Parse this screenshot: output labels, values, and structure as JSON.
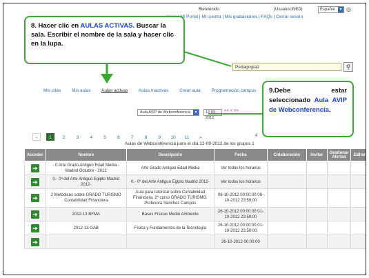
{
  "header": {
    "welcome": "Bienvenido",
    "user": "(UsuarioUNED)",
    "language": "Español",
    "go_label": "",
    "links": "Inicio | Mi Portal | Mi cuenta | Mis grabaciones | FAQs | Cerrar sesión"
  },
  "search": {
    "value": "Pedagogía2"
  },
  "tabs": [
    {
      "label": "Mis citas"
    },
    {
      "label": "Mis aulas"
    },
    {
      "label": "Aulas activas"
    },
    {
      "label": "Aulas Inactivas"
    },
    {
      "label": "Crear aula"
    },
    {
      "label": "Programación campus"
    }
  ],
  "filter": {
    "type": "Aula AVIP de Webconferencia",
    "date": "12-09-2012",
    "nav": "<< < >>"
  },
  "pager": {
    "prev": "‹",
    "pages": [
      "1",
      "2",
      "3",
      "4",
      "5",
      "6",
      "7",
      "8",
      "9",
      "10",
      "11"
    ],
    "next": "»",
    "right": "4"
  },
  "table": {
    "caption": "Aulas de Webconferencia para el día 12-09-2012 de los grupos 1",
    "headers": [
      "Acceder",
      "Nombre",
      "Descripción",
      "Fecha",
      "Colaboración",
      "Invitar",
      "Gestionar Alertas",
      "Editar"
    ],
    "rows": [
      {
        "nombre": "- 0 Arte Grado Antiguo Edad Media - Madrid Octubre - 2012",
        "descripcion": "Arte Grado Antiguo Edad Media",
        "fecha": "Ver todos los horarios"
      },
      {
        "nombre": "0.- 0º del Arte Antiguo Egipto Madrid 2012-",
        "descripcion": "0.- 0º del Arte Antiguo Egipto Madrid 2012-",
        "fecha": "Ver todos los horarios"
      },
      {
        "nombre": "2 Metódicos sobre GRADO TURISMO Contabilidad Financiera",
        "descripcion": "Aula para tutorizar sobre Contabilidad Financiera, 2º curso GRADO TURISMO. Profesora Sánchez Campos",
        "fecha": "08-10-2012 00:00:00 08-10-2012 23:59:00"
      },
      {
        "nombre": "2012-13 BFMA",
        "descripcion": "Bases Físicas Medio Ambiente",
        "fecha": "26-10-2012 00:00:00 01-10-2012 23:59:00"
      },
      {
        "nombre": "2012-13 GAB",
        "descripcion": "Física y Fundamentos de la Tecnología",
        "fecha": "26-10-2012 00:00:00 01-10-2012 23:59:00"
      },
      {
        "nombre": "",
        "descripcion": "",
        "fecha": "26-10-2012 00:00:00"
      }
    ]
  },
  "callouts": {
    "c1_part1": "8. Hacer clic en ",
    "c1_highlight": "AULAS ACTIVAS",
    "c1_part2": ". Buscar la sala. Escribir el nombre de la sala y hacer clic en la lupa.",
    "c2_part1": "9.Debe estar seleccionado ",
    "c2_highlight": "Aula AVIP de Webconferencia",
    "c2_part2": "."
  },
  "colors": {
    "callout_border": "#3aa832",
    "highlight": "#1d3fd6",
    "header_bg": "#8a8a8a",
    "link": "#2a6db3"
  }
}
